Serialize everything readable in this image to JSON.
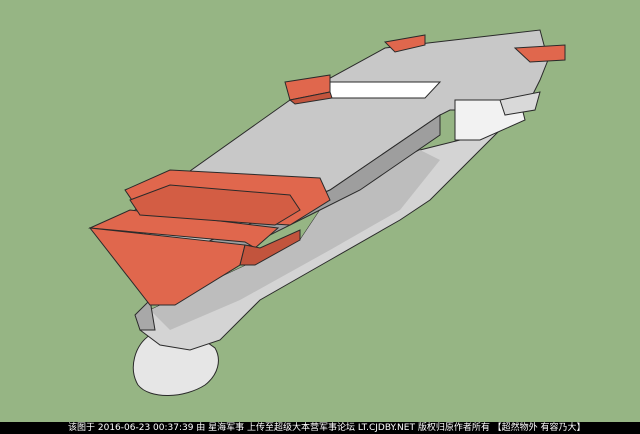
{
  "scene": {
    "subject": "3D model of aircraft carrier hull (SketchUp render)",
    "colors": {
      "background": "#96b584",
      "hull_light": "#d9d9d9",
      "hull_mid": "#b4b4b4",
      "hull_dark": "#8e8e8e",
      "deck": "#c4c4c4",
      "accent_orange": "#e0674d",
      "accent_orange_dark": "#c2543d",
      "white": "#ffffff",
      "outline": "#2a2a2a"
    }
  },
  "watermark": {
    "text": "该图于 2016-06-23 00:37:39 由 星海军事 上传至超级大本营军事论坛 LT.CJDBY.NET 版权归原作者所有 【超然物外 有容乃大】"
  }
}
